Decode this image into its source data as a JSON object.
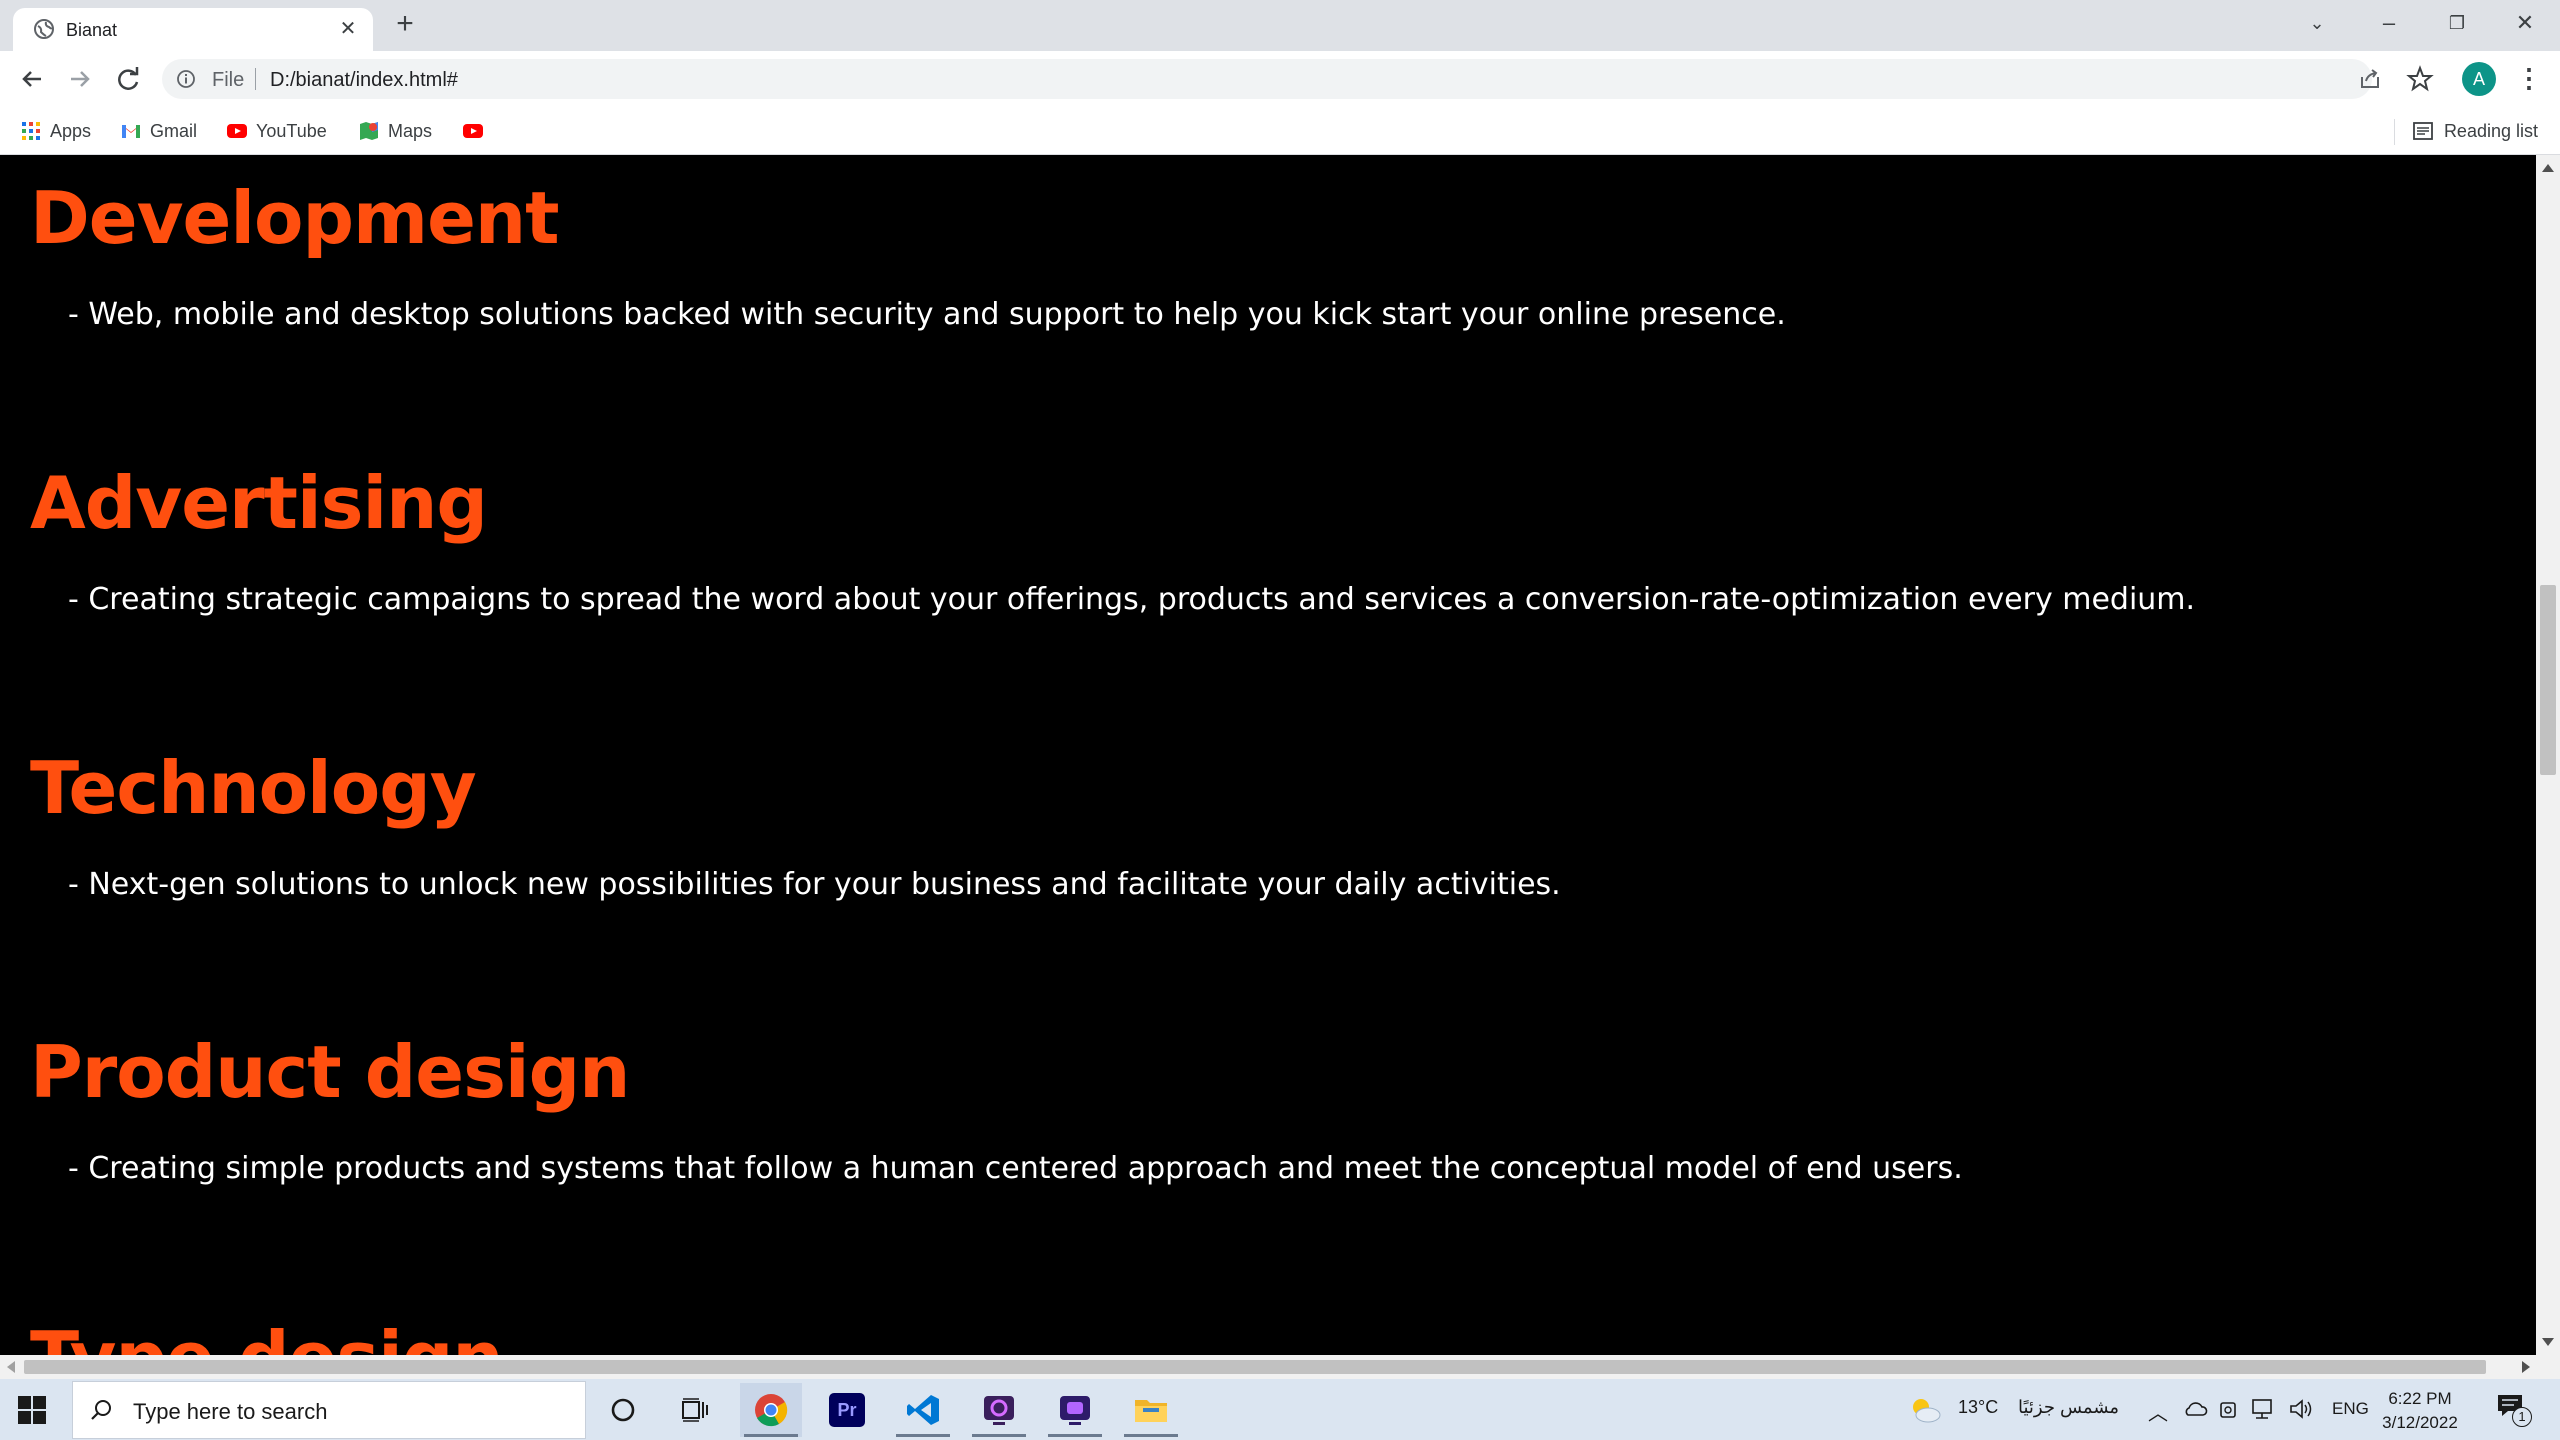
{
  "browser": {
    "tab_title": "Bianat",
    "omnibox_scheme": "File",
    "omnibox_url": "D:/bianat/index.html#",
    "profile_initial": "A",
    "bookmarks": [
      {
        "label": "Apps",
        "icon": "apps-grid-icon"
      },
      {
        "label": "Gmail",
        "icon": "gmail-icon"
      },
      {
        "label": "YouTube",
        "icon": "youtube-icon"
      },
      {
        "label": "Maps",
        "icon": "maps-icon"
      }
    ],
    "reading_list": "Reading list"
  },
  "page": {
    "accent_color": "#ff4f0f",
    "sections": [
      {
        "title": "Development",
        "text": "- Web, mobile and desktop solutions backed with security and support to help you kick start your online presence."
      },
      {
        "title": "Advertising",
        "text": "- Creating strategic campaigns to spread the word about your offerings, products and services a conversion-rate-optimization every medium."
      },
      {
        "title": "Technology",
        "text": "- Next-gen solutions to unlock new possibilities for your business and facilitate your daily activities."
      },
      {
        "title": "Product design",
        "text": "- Creating simple products and systems that follow a human centered approach and meet the conceptual model of end users."
      },
      {
        "title": "Type design",
        "text": ""
      }
    ]
  },
  "taskbar": {
    "search_placeholder": "Type here to search",
    "weather_temp": "13°C",
    "weather_text": "مشمس جزئيًا",
    "language": "ENG",
    "time": "6:22 PM",
    "date": "3/12/2022",
    "notification_count": "1"
  }
}
